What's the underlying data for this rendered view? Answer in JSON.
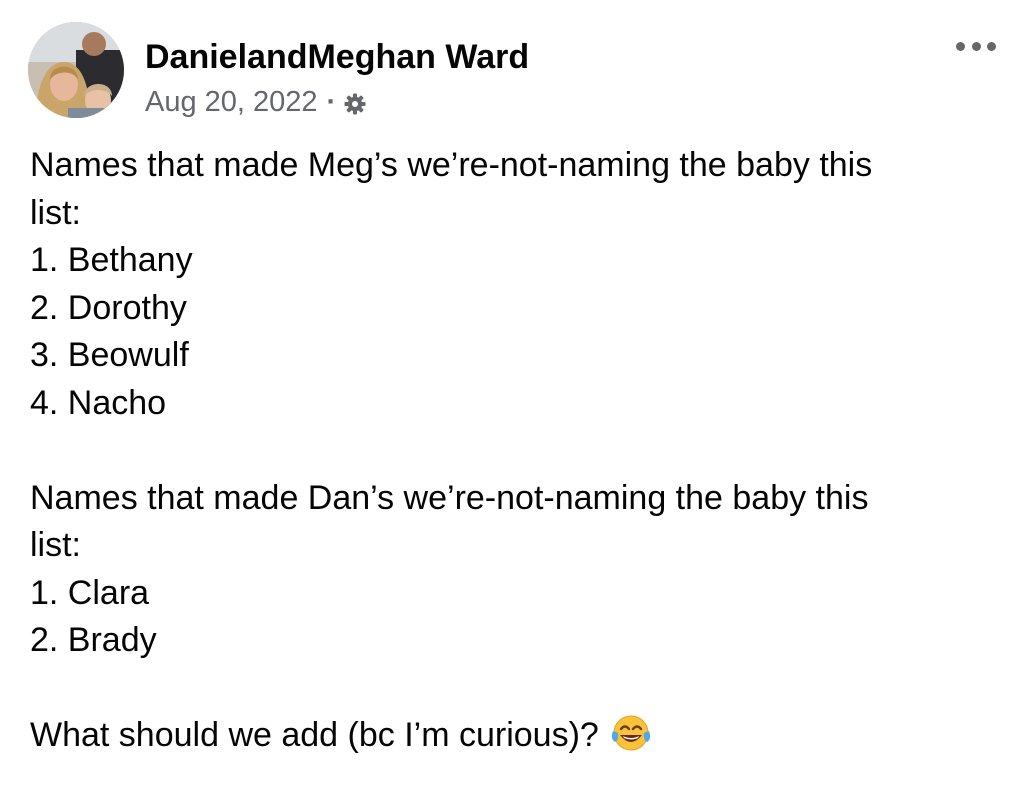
{
  "post": {
    "author": "DanielandMeghan Ward",
    "date": "Aug 20, 2022",
    "separator": "·",
    "audience_icon": "gear-icon",
    "more_icon": "more-options-icon",
    "avatar": "profile-photo-avatar",
    "lines": [
      "Names that made Meg’s we’re-not-naming the baby this",
      "list:",
      "1. Bethany",
      "2. Dorothy",
      "3. Beowulf",
      "4. Nacho",
      "",
      "Names that made Dan’s we’re-not-naming the baby this",
      "list:",
      "1. Clara",
      "2. Brady",
      "",
      "What should we add (bc I’m curious)?"
    ],
    "emoji": "tears-of-joy-emoji"
  },
  "colors": {
    "text": "#050505",
    "secondary": "#65676b",
    "background": "#ffffff"
  }
}
